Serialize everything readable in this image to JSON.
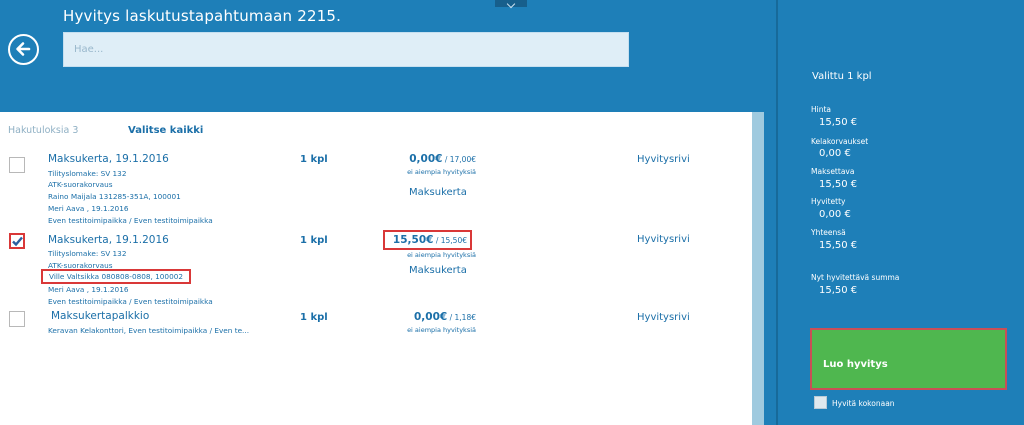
{
  "header": {
    "title": "Hyvitys laskutustapahtumaan 2215.",
    "search_placeholder": "Hae...",
    "search_value": ""
  },
  "results": {
    "count_label": "Hakutuloksia 3",
    "select_all": "Valitse kaikki",
    "items": [
      {
        "checked": false,
        "title": "Maksukerta, 19.1.2016",
        "details": [
          "Tilityslomake: SV 132",
          "ATK-suorakorvaus",
          "Raino Maijala 131285-351A, 100001",
          "Meri Aava , 19.1.2016",
          "Even testitoimipaikka / Even testitoimipaikka"
        ],
        "qty": "1 kpl",
        "price_main": "0,00€",
        "price_sep": " / ",
        "price_orig": "17,00€",
        "price_note": "ei aiempia hyvityksiä",
        "type": "Maksukerta",
        "action": "Hyvitysrivi"
      },
      {
        "checked": true,
        "title": "Maksukerta, 19.1.2016",
        "details": [
          "Tilityslomake: SV 132",
          "ATK-suorakorvaus",
          "Ville Valtsikka 080808-0808, 100002",
          "Meri Aava , 19.1.2016",
          "Even testitoimipaikka / Even testitoimipaikka"
        ],
        "qty": "1 kpl",
        "price_main": "15,50€",
        "price_sep": " / ",
        "price_orig": "15,50€",
        "price_note": "ei aiempia hyvityksiä",
        "type": "Maksukerta",
        "action": "Hyvitysrivi"
      },
      {
        "checked": false,
        "title": "Maksukertapalkkio",
        "details": [
          "Keravan Kelakonttori, Even testitoimipaikka / Even te..."
        ],
        "qty": "1 kpl",
        "price_main": "0,00€",
        "price_sep": " / ",
        "price_orig": "1,18€",
        "price_note": "ei aiempia hyvityksiä",
        "type": "",
        "action": "Hyvitysrivi"
      }
    ]
  },
  "summary": {
    "selected": "Valittu 1 kpl",
    "fields": [
      {
        "label": "Hinta",
        "value": "15,50 €"
      },
      {
        "label": "Kelakorvaukset",
        "value": "0,00 €"
      },
      {
        "label": "Maksettava",
        "value": "15,50 €"
      },
      {
        "label": "Hyvitetty",
        "value": "0,00 €"
      },
      {
        "label": "Yhteensä",
        "value": "15,50 €"
      },
      {
        "label": "Nyt hyvitettävä summa",
        "value": "15,50 €"
      }
    ],
    "create_button": "Luo hyvitys",
    "full_credit_label": "Hyvitä kokonaan",
    "full_credit_checked": false
  },
  "colors": {
    "primary": "#1e7fb8",
    "text_link": "#1b6fa8",
    "create_button": "#4fb74f",
    "highlight": "#d93838"
  },
  "icons": {
    "back": "back-arrow-circle-icon",
    "check": "checkmark-icon",
    "handle": "chevron-down-icon"
  }
}
